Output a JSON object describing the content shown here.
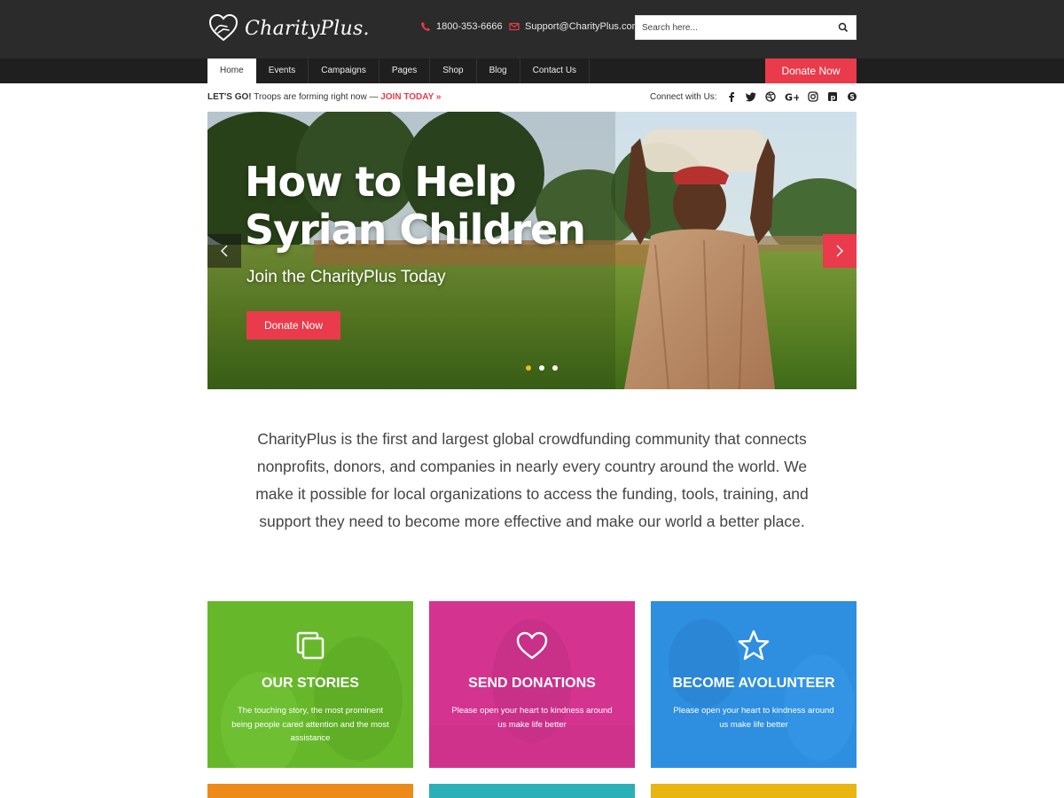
{
  "header": {
    "logo_text": "CharityPlus.",
    "phone": "1800-353-6666",
    "email": "Support@CharityPlus.com",
    "search_placeholder": "Search here..."
  },
  "nav": {
    "items": [
      {
        "label": "Home",
        "active": true
      },
      {
        "label": "Events"
      },
      {
        "label": "Campaigns"
      },
      {
        "label": "Pages"
      },
      {
        "label": "Shop"
      },
      {
        "label": "Blog"
      },
      {
        "label": "Contact Us"
      }
    ],
    "donate_label": "Donate Now"
  },
  "announcement": {
    "lead": "LET'S GO!",
    "text": " Troops are forming right now — ",
    "cta": "JOIN TODAY »"
  },
  "social": {
    "label": "Connect with Us:",
    "icons": [
      "facebook-icon",
      "twitter-icon",
      "dribbble-icon",
      "google-plus-icon",
      "instagram-icon",
      "pinterest-icon",
      "skype-icon"
    ]
  },
  "hero": {
    "title": "How to Help Syrian Children",
    "subtitle": "Join the CharityPlus Today",
    "button": "Donate Now",
    "active_slide": 1,
    "slide_count": 3
  },
  "intro": {
    "text": "CharityPlus is the first and largest global crowdfunding community that connects nonprofits, donors, and companies in nearly every country around the world. We make it possible for local organizations to access the funding, tools, training, and support they need to become more effective and make our world a better place."
  },
  "cards": [
    {
      "title": "OUR STORIES",
      "text": "The touching story, the most prominent being people cared attention and the most assistance",
      "icon": "copy-icon",
      "color": "#66b82a"
    },
    {
      "title": "SEND DONATIONS",
      "text": "Please open your heart to kindness around us make life better",
      "icon": "heart-icon",
      "color": "#d4348f"
    },
    {
      "title": "BECOME AVOLUNTEER",
      "text": "Please open your heart to kindness around us make life better",
      "icon": "star-icon",
      "color": "#2e8ee0"
    }
  ],
  "bottom_cards_colors": [
    "#ee8a1a",
    "#2ab0b6",
    "#e8b512"
  ],
  "colors": {
    "accent": "#e93b4c",
    "header_bg": "#2b2b2b",
    "nav_bg": "#1f1f1f",
    "dot_active": "#f3b623"
  }
}
